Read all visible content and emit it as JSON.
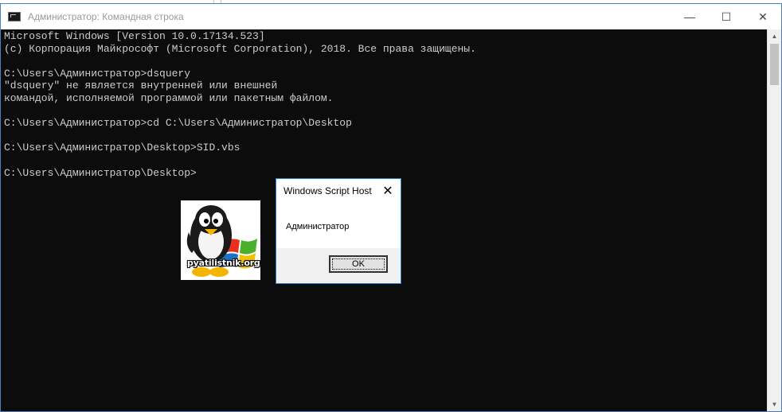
{
  "window": {
    "title": "Администратор: Командная строка",
    "controls": {
      "minimize": "—",
      "maximize": "☐",
      "close": "✕"
    }
  },
  "console": {
    "lines": [
      "Microsoft Windows [Version 10.0.17134.523]",
      "(c) Корпорация Майкрософт (Microsoft Corporation), 2018. Все права защищены.",
      "",
      "C:\\Users\\Администратор>dsquery",
      "\"dsquery\" не является внутренней или внешней",
      "командой, исполняемой программой или пакетным файлом.",
      "",
      "C:\\Users\\Администратор>cd C:\\Users\\Администратор\\Desktop",
      "",
      "C:\\Users\\Администратор\\Desktop>SID.vbs",
      "",
      "C:\\Users\\Администратор\\Desktop>"
    ]
  },
  "scrollbar": {
    "up_icon": "▲",
    "down_icon": "▼"
  },
  "logo": {
    "text": "pyatilistnik.org"
  },
  "dialog": {
    "title": "Windows Script Host",
    "close": "✕",
    "message": "Администратор",
    "ok_label": "OK"
  },
  "colors": {
    "console_bg": "#0c0c0c",
    "console_fg": "#cccccc",
    "accent": "#2b7cd3"
  }
}
